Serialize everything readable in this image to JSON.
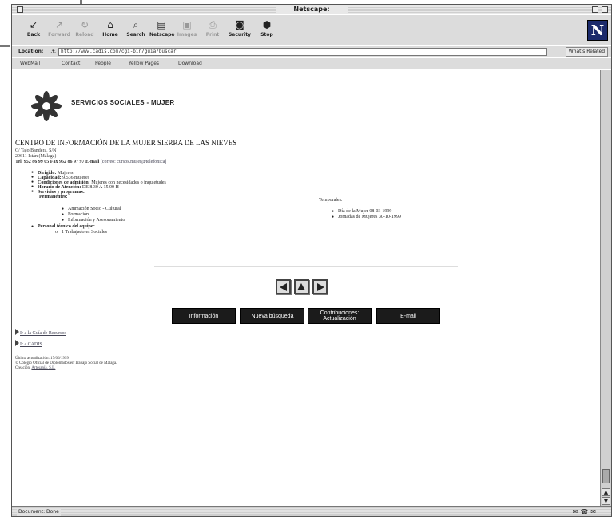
{
  "window": {
    "title": "Netscape:"
  },
  "toolbar": {
    "buttons": [
      {
        "label": "Back",
        "icon": "back-arrow-icon"
      },
      {
        "label": "Forward",
        "icon": "forward-arrow-icon"
      },
      {
        "label": "Reload",
        "icon": "reload-icon"
      },
      {
        "label": "Home",
        "icon": "home-icon"
      },
      {
        "label": "Search",
        "icon": "search-icon"
      },
      {
        "label": "Netscape",
        "icon": "netscape-icon"
      },
      {
        "label": "Images",
        "icon": "images-icon"
      },
      {
        "label": "Print",
        "icon": "print-icon"
      },
      {
        "label": "Security",
        "icon": "security-icon"
      },
      {
        "label": "Stop",
        "icon": "stop-icon"
      }
    ],
    "logo": "N"
  },
  "location": {
    "label": "Location:",
    "url": "http://www.cadis.com/cgi-bin/guia/buscar",
    "related": "What's Related"
  },
  "personal_toolbar": {
    "items": [
      "WebMail",
      "Contact",
      "People",
      "Yellow Pages",
      "Download"
    ]
  },
  "page": {
    "logo_text": "SERVICIOS SOCIALES - MUJER",
    "center_title": "CENTRO DE INFORMACIÓN DE LA MUJER SIERRA DE LAS NIEVES",
    "address_line1": "C/ Tajo Bandera, S/N",
    "address_line2": "29611 Istán (Málaga)",
    "contact_prefix": "Tel. 952 86 99 05 Fax 952 86 97 97 E-mail",
    "contact_email": "[correo: cursos.mujer@telefonica]",
    "details": [
      {
        "label": "Dirigido:",
        "value": " Mujeres"
      },
      {
        "label": "Capacidad:",
        "value": " 9.536 mujeres"
      },
      {
        "label": "Condiciones de admisión:",
        "value": " Mujeres con necesidades o inquietudes"
      },
      {
        "label": "Horario de Atención:",
        "value": " DE 8.30 A 15.00 H"
      },
      {
        "label": "Servicios y programas:",
        "value": ""
      }
    ],
    "permanentes_label": "Permanentes:",
    "permanentes": [
      "Animación Socio - Cultural",
      "Formación",
      "Información y Asesoramiento"
    ],
    "temporales_label": "Temporales:",
    "temporales": [
      "Día de la Mujer 08-03-1999",
      "Jornadas de Mujeres 30-10-1999"
    ],
    "personal_label": "Personal técnico del equipo:",
    "personal_items": [
      "1 Trabajadores Sociales"
    ],
    "nav_buttons": [
      "Información",
      "Nueva búsqueda",
      "Contribuciones: Actualización",
      "E-mail"
    ],
    "links": [
      "Ir a la Guía de Recursos",
      "Ir a CADIS"
    ],
    "footer": [
      "Última actualización: 17/06/1999",
      "© Colegio Oficial de Diplomados en Trabajo Social de Málaga.",
      "Creación: "
    ],
    "footer_link": "Artesanía, S.L."
  },
  "status": {
    "text": "Document: Done"
  }
}
